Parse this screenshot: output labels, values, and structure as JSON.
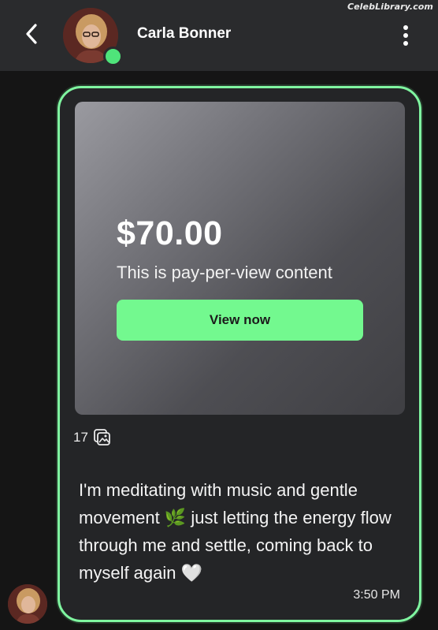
{
  "watermark": "CelebLibrary.com",
  "header": {
    "contact_name": "Carla Bonner",
    "online_status_color": "#4fe47a",
    "back_icon": "chevron-left-icon",
    "more_icon": "vertical-dots-icon"
  },
  "ppv": {
    "price": "$70.00",
    "description": "This is pay-per-view content",
    "button_label": "View now",
    "accent_color": "#73f98f"
  },
  "media": {
    "count": "17",
    "icon": "photo-stack-icon"
  },
  "message": {
    "text_part1": "I'm meditating with music and gentle movement ",
    "emoji1": "🌿",
    "text_part2": " just letting the energy flow through me and settle, coming back to myself again ",
    "emoji2": "🤍",
    "time": "3:50 PM"
  },
  "bubble": {
    "border_color": "#7ff5a0"
  }
}
